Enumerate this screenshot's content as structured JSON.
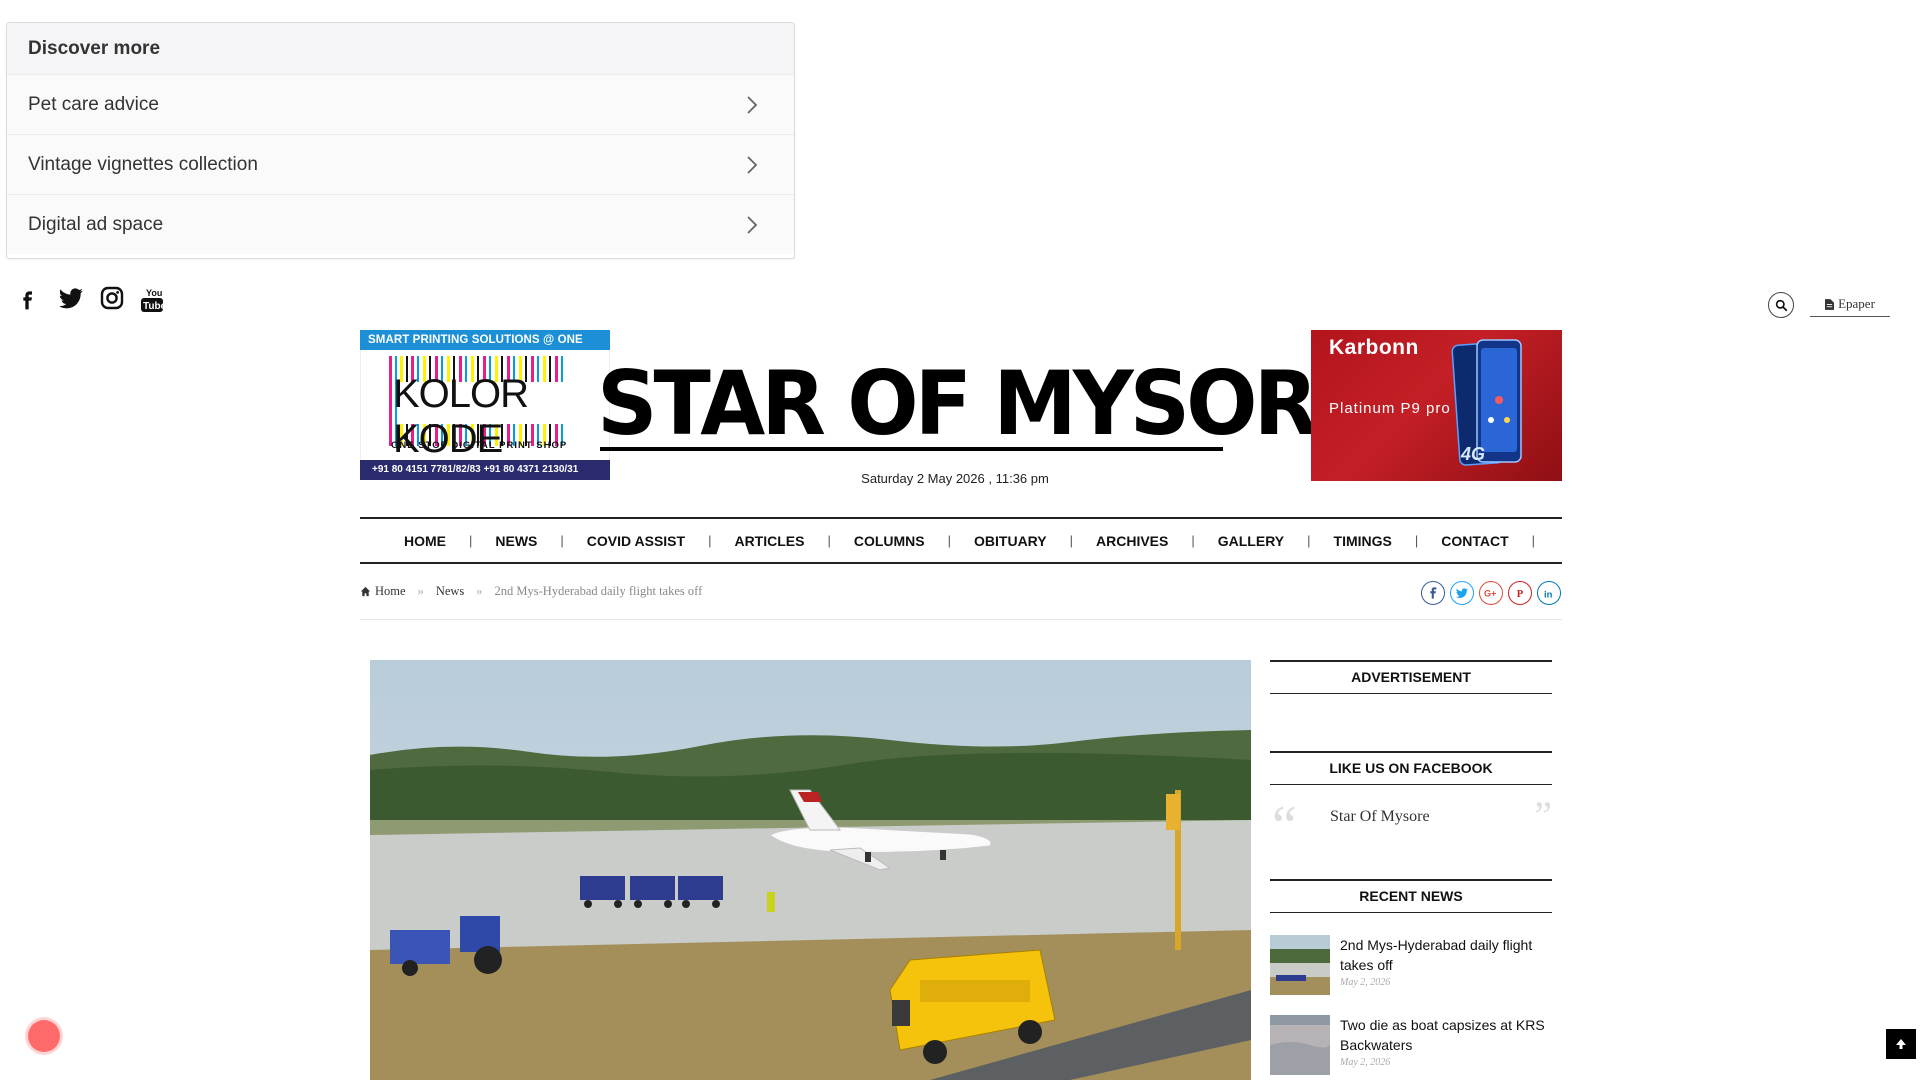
{
  "discover": {
    "title": "Discover more",
    "items": [
      {
        "label": "Pet care advice"
      },
      {
        "label": "Vintage vignettes collection"
      },
      {
        "label": "Digital ad space"
      }
    ]
  },
  "topbar": {
    "social_icons": [
      "facebook-icon",
      "twitter-icon",
      "instagram-icon",
      "youtube-icon"
    ],
    "epaper_label": "Epaper"
  },
  "ad_left": {
    "top_text": "SMART PRINTING SOLUTIONS @ ONE STOP",
    "brand": "KOLOR KODE",
    "tagline": "ONE STOP DIGITAL PRINT SHOP",
    "phone": "+91 80 4151 7781/82/83 +91 80 4371 2130/31"
  },
  "masthead": {
    "title": "STAR OF MYSORE",
    "datetime": "Saturday 2 May 2026 , 11:36 pm"
  },
  "ad_right": {
    "brand": "Karbonn",
    "model": "Platinum P9 pro",
    "badge": "4G"
  },
  "nav": {
    "items": [
      "HOME",
      "NEWS",
      "COVID ASSIST",
      "ARTICLES",
      "COLUMNS",
      "OBITUARY",
      "ARCHIVES",
      "GALLERY",
      "TIMINGS",
      "CONTACT"
    ]
  },
  "breadcrumb": {
    "home": "Home",
    "section": "News",
    "current": "2nd Mys-Hyderabad daily flight takes off"
  },
  "share_colors": {
    "facebook": "#3b5998",
    "twitter": "#1da1f2",
    "google": "#dd4b39",
    "pinterest": "#cb2027",
    "linkedin": "#0077b5"
  },
  "sidebar": {
    "advertisement": "ADVERTISEMENT",
    "facebook_head": "LIKE US ON FACEBOOK",
    "facebook_page": "Star Of Mysore",
    "recent_head": "RECENT NEWS",
    "recent": [
      {
        "title": "2nd Mys-Hyderabad daily flight takes off",
        "date": "May 2, 2026"
      },
      {
        "title": "Two die as boat capsizes at KRS Backwaters",
        "date": "May 2, 2026"
      }
    ]
  }
}
